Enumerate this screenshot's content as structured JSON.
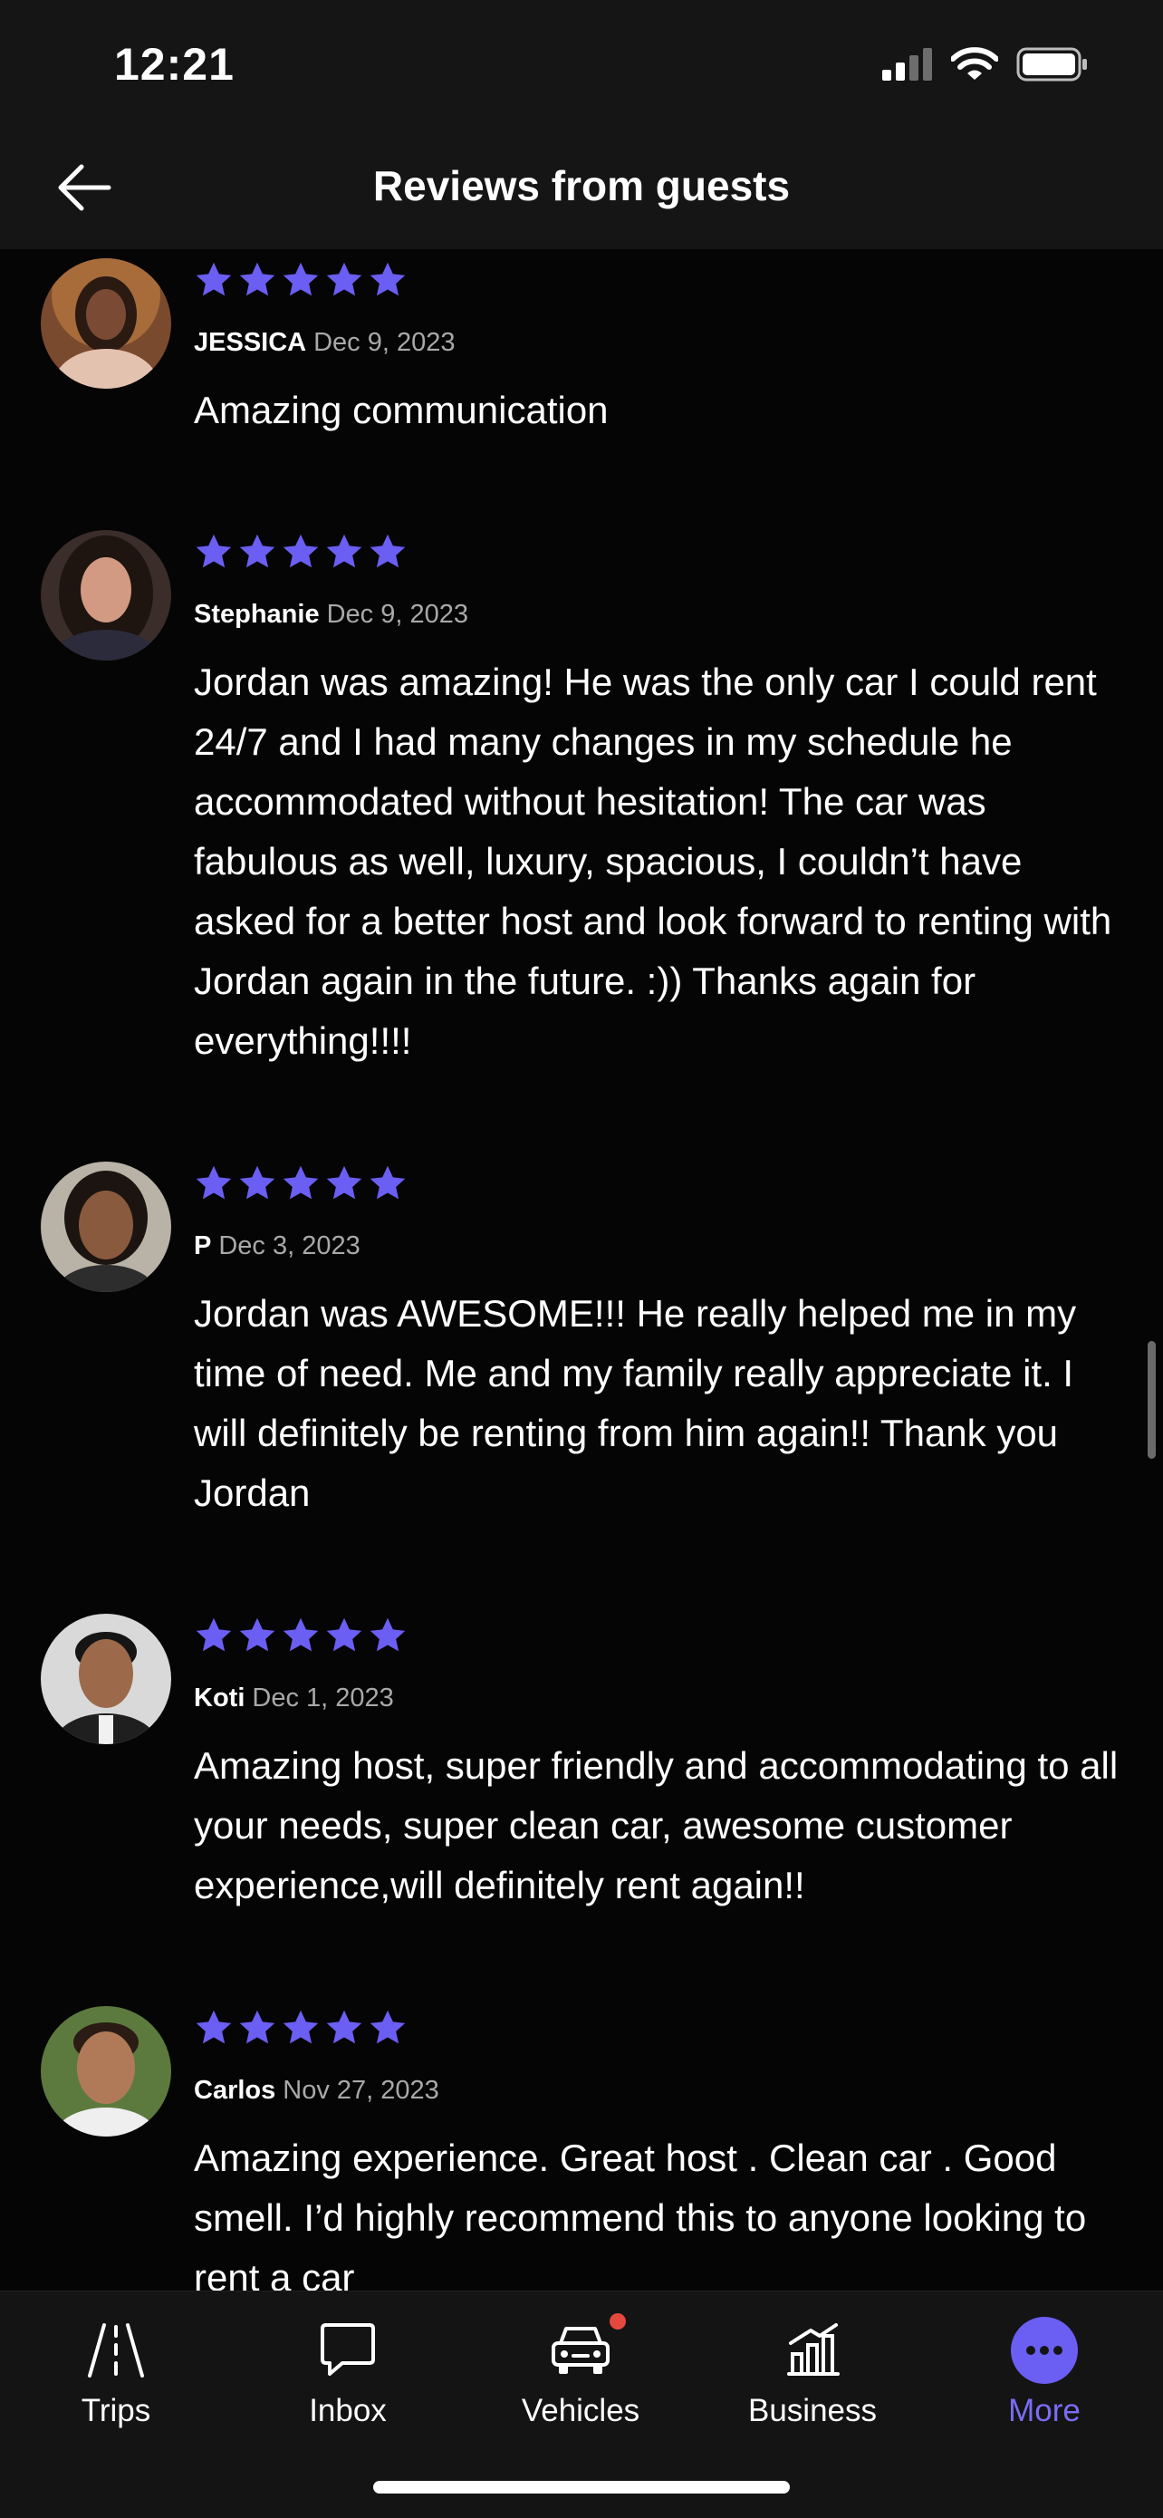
{
  "status_bar": {
    "time": "12:21"
  },
  "header": {
    "title": "Reviews from guests"
  },
  "reviews": [
    {
      "name": "JESSICA",
      "date": "Dec 9, 2023",
      "stars": 5,
      "text": "Amazing communication"
    },
    {
      "name": "Stephanie",
      "date": "Dec 9, 2023",
      "stars": 5,
      "text": "Jordan was amazing! He was the only car I could rent 24/7 and I had many changes in my schedule he accommodated without hesitation! The car was fabulous as well, luxury, spacious, I couldn’t have asked for a better host and look forward to renting with Jordan again in the future. :)) Thanks again for everything!!!!"
    },
    {
      "name": "P",
      "date": "Dec 3, 2023",
      "stars": 5,
      "text": "Jordan was AWESOME!!! He really helped me in my time of need. Me and my family really appreciate it. I will definitely be renting from him again!! Thank you Jordan"
    },
    {
      "name": "Koti",
      "date": "Dec 1, 2023",
      "stars": 5,
      "text": "Amazing host, super friendly and accommodating to all your needs, super clean car, awesome customer experience,will definitely rent again!!"
    },
    {
      "name": "Carlos",
      "date": "Nov 27, 2023",
      "stars": 5,
      "text": "Amazing experience. Great host . Clean car . Good smell. I’d highly recommend this to anyone looking to rent a car"
    }
  ],
  "tabs": [
    {
      "label": "Trips",
      "icon": "road-icon"
    },
    {
      "label": "Inbox",
      "icon": "chat-bubble-icon"
    },
    {
      "label": "Vehicles",
      "icon": "car-icon"
    },
    {
      "label": "Business",
      "icon": "bar-chart-icon"
    },
    {
      "label": "More",
      "icon": "more-dots-icon"
    }
  ],
  "colors": {
    "accent": "#6b5ef2",
    "background": "#050505",
    "header": "#151515",
    "notification": "#e5483f"
  }
}
